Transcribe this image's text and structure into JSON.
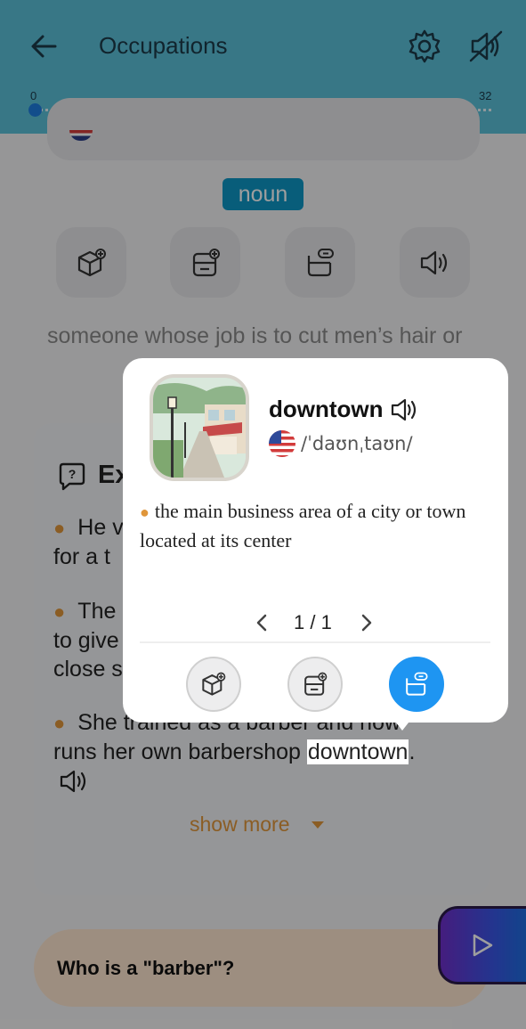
{
  "header": {
    "title": "Occupations",
    "progress": {
      "min_label": "0",
      "max_label": "32",
      "current": 0,
      "total": 32
    },
    "icons": [
      "back-arrow-icon",
      "gear-icon",
      "sound-off-icon"
    ]
  },
  "entry": {
    "part_of_speech": "noun",
    "definition": "someone whose job is to cut men’s hair or",
    "actions": [
      "add-to-deck",
      "remove-from-deck",
      "link-card",
      "speaker"
    ]
  },
  "examples": {
    "title": "Ex",
    "items": [
      {
        "line1": "He v",
        "line2": "for a t"
      },
      {
        "line1": "The",
        "line2": "to give",
        "line3": "close s"
      },
      {
        "line1": "She trained as a barber and now",
        "line2_before": "runs her own barbershop ",
        "highlight": "downtown",
        "line2_after": "."
      }
    ],
    "show_more": "show more"
  },
  "question": {
    "text": "Who is a \"barber\"?"
  },
  "popup": {
    "word": "downtown",
    "ipa": "/ˈdaʊnˌtaʊn/",
    "definition": "the main business area of a city or town located at its center",
    "pager": "1 / 1",
    "buttons": [
      "add-to-deck",
      "remove-from-deck",
      "link-card"
    ],
    "active_button": "link-card",
    "accent_color": "#1e95f2"
  },
  "colors": {
    "header": "#5bc0d9",
    "badge": "#0d96c6",
    "bullet": "#e0963a",
    "question_bg": "#fde6cf"
  }
}
